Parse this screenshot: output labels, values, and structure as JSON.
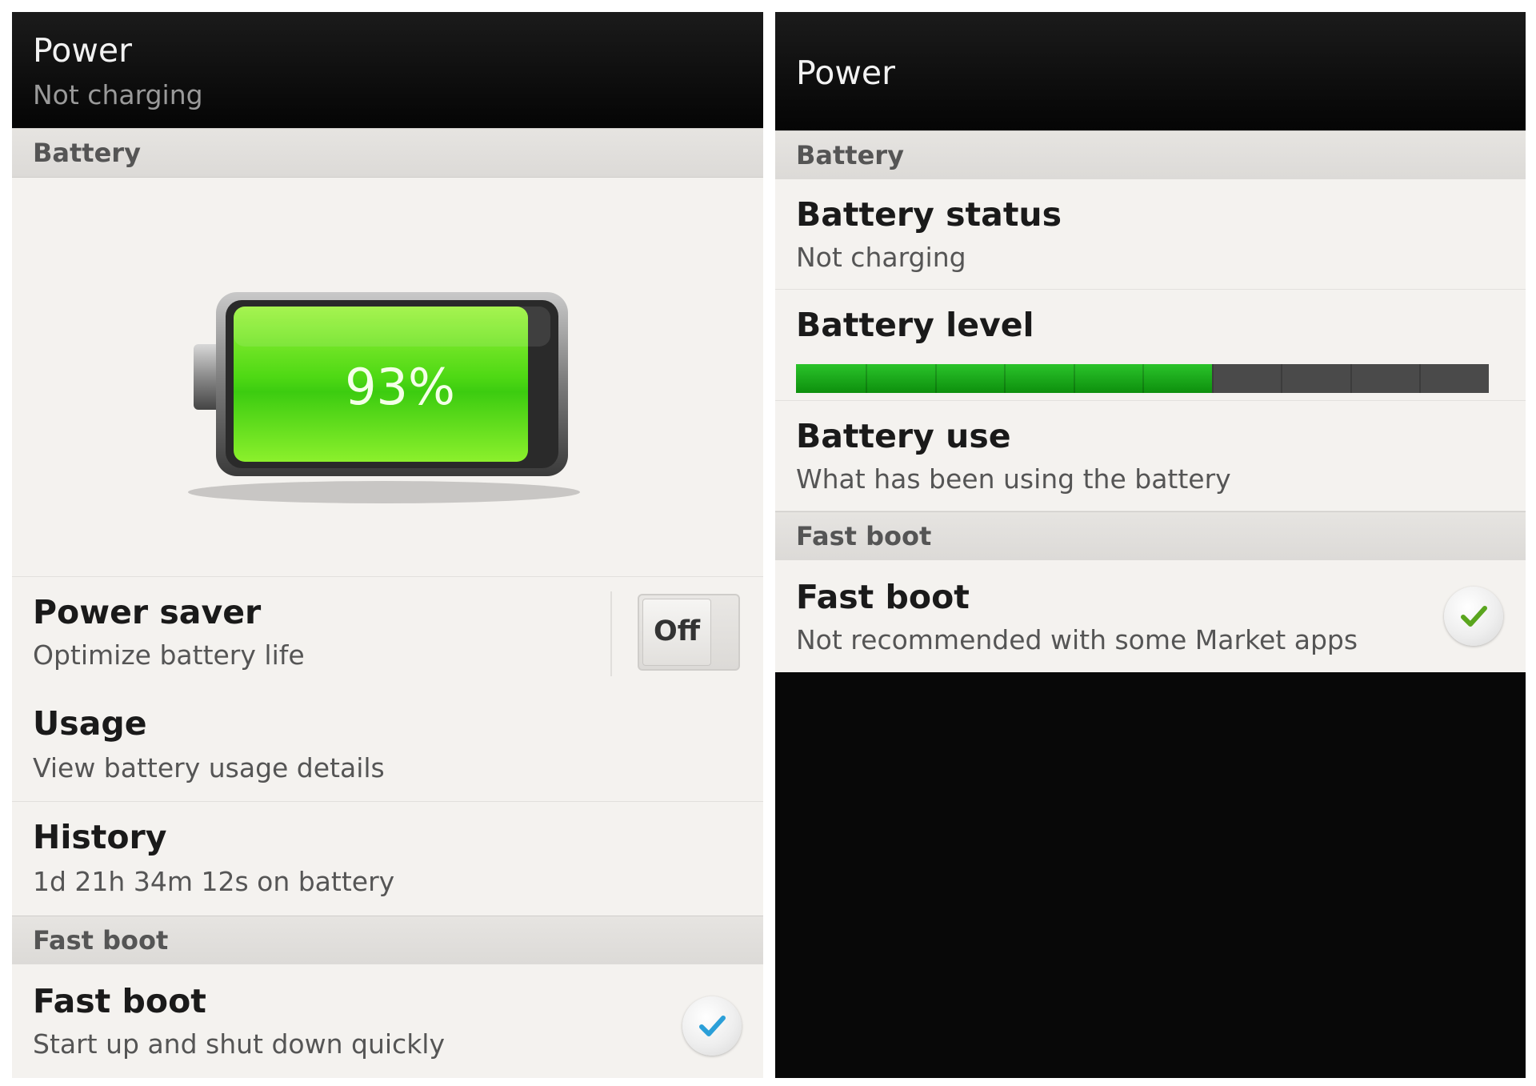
{
  "left": {
    "header": {
      "title": "Power",
      "subtitle": "Not charging"
    },
    "battery_section": {
      "label": "Battery"
    },
    "battery_graphic": {
      "percent_text": "93%",
      "level_percent": 93
    },
    "power_saver": {
      "title": "Power saver",
      "subtitle": "Optimize battery life",
      "toggle_label": "Off"
    },
    "usage": {
      "title": "Usage",
      "subtitle": "View battery usage details"
    },
    "history": {
      "title": "History",
      "subtitle": "1d 21h 34m 12s on battery"
    },
    "fast_boot_section": {
      "label": "Fast boot"
    },
    "fast_boot": {
      "title": "Fast boot",
      "subtitle": "Start up and shut down quickly",
      "checked": true,
      "check_color": "#2b9fd8"
    }
  },
  "right": {
    "header": {
      "title": "Power"
    },
    "battery_section": {
      "label": "Battery"
    },
    "battery_status": {
      "title": "Battery status",
      "subtitle": "Not charging"
    },
    "battery_level": {
      "title": "Battery level",
      "level_fraction": 0.6
    },
    "battery_use": {
      "title": "Battery use",
      "subtitle": "What has been using the battery"
    },
    "fast_boot_section": {
      "label": "Fast boot"
    },
    "fast_boot": {
      "title": "Fast boot",
      "subtitle": "Not recommended with some Market apps",
      "checked": true,
      "check_color": "#5aa51e"
    }
  },
  "colors": {
    "battery_green": "#5fe01a",
    "level_green": "#1aa81a",
    "header_bg": "#0a0a0a"
  }
}
